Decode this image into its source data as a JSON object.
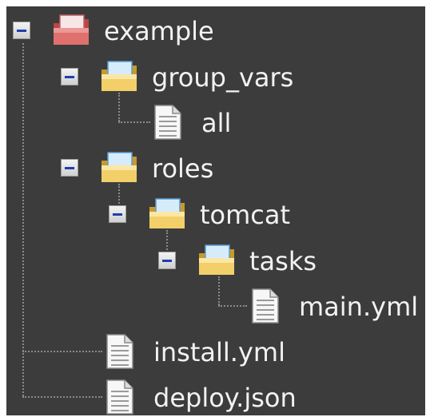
{
  "tree": {
    "root": {
      "label": "example",
      "icon": "red-folder-icon",
      "expanded": true
    },
    "group_vars": {
      "label": "group_vars",
      "icon": "folder-icon",
      "expanded": true
    },
    "all": {
      "label": "all",
      "icon": "file-icon"
    },
    "roles": {
      "label": "roles",
      "icon": "folder-icon",
      "expanded": true
    },
    "tomcat": {
      "label": "tomcat",
      "icon": "folder-icon",
      "expanded": true
    },
    "tasks": {
      "label": "tasks",
      "icon": "folder-icon",
      "expanded": true
    },
    "main_yml": {
      "label": "main.yml",
      "icon": "file-icon"
    },
    "install_yml": {
      "label": "install.yml",
      "icon": "file-icon"
    },
    "deploy_json": {
      "label": "deploy.json",
      "icon": "file-icon"
    }
  },
  "colors": {
    "background": "#3c3c3c",
    "text": "#f2f2f2",
    "folder": "#f3cf6a",
    "root_folder": "#d9605f",
    "toggle_minus": "#1f3fb0"
  }
}
